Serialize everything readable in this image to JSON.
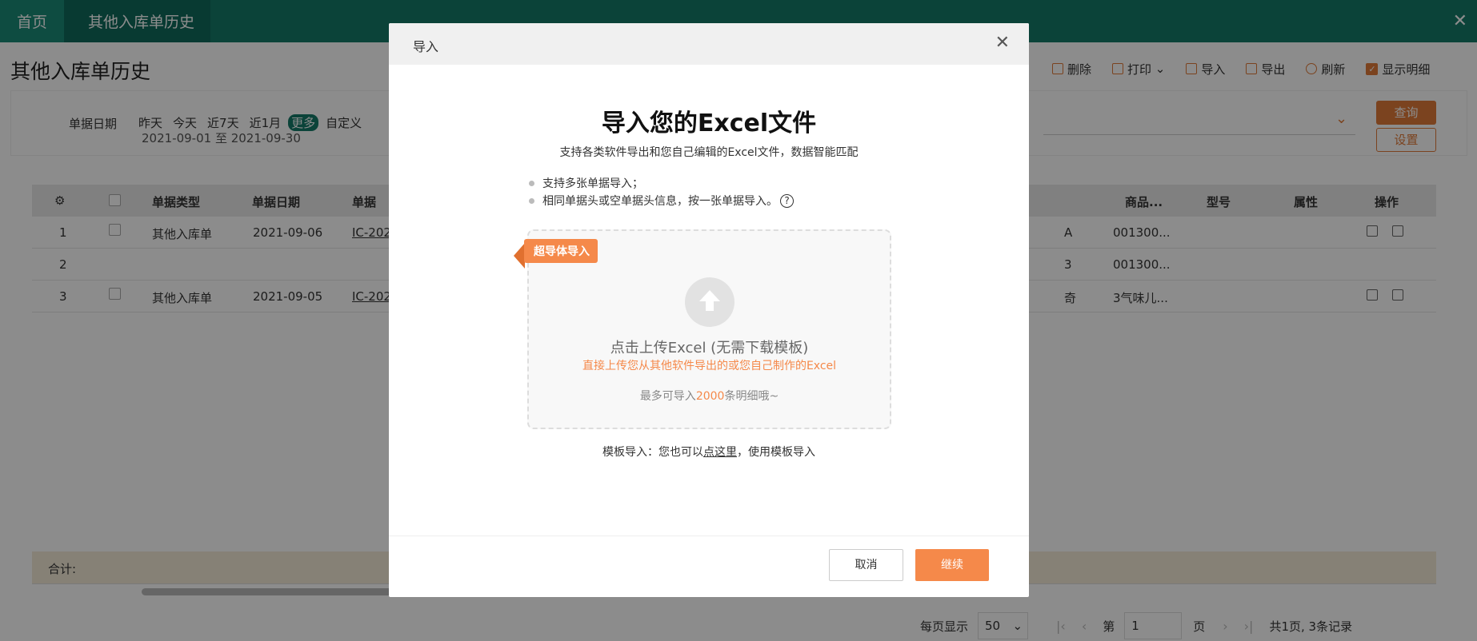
{
  "tabs": {
    "home": "首页",
    "active": "其他入库单历史"
  },
  "page": {
    "title": "其他入库单历史"
  },
  "toolbar": {
    "delete": "删除",
    "print": "打印",
    "import": "导入",
    "export": "导出",
    "refresh": "刷新",
    "show_detail": "显示明细"
  },
  "filter": {
    "label": "单据日期",
    "options": [
      "昨天",
      "今天",
      "近7天",
      "近1月",
      "更多",
      "自定义"
    ],
    "range": "2021-09-01 至 2021-09-30",
    "query": "查询",
    "settings": "设置"
  },
  "table": {
    "headers": {
      "type": "单据类型",
      "date": "单据日期",
      "no": "单据",
      "goods": "商品...",
      "model": "型号",
      "attr": "属性",
      "ops": "操作"
    },
    "rows": [
      {
        "idx": "1",
        "type": "其他入库单",
        "date": "2021-09-06",
        "no": "IC-202",
        "col5": "A",
        "goods": "001300..."
      },
      {
        "idx": "2",
        "type": "",
        "date": "",
        "no": "",
        "col5": "3",
        "goods": "001300..."
      },
      {
        "idx": "3",
        "type": "其他入库单",
        "date": "2021-09-05",
        "no": "IC-202",
        "col5": "奇",
        "goods": "3气味儿..."
      }
    ],
    "sum_label": "合计:"
  },
  "pager": {
    "per_page_label": "每页显示",
    "per_page": "50",
    "page_prefix": "第",
    "page": "1",
    "page_suffix": "页",
    "total": "共1页, 3条记录"
  },
  "modal": {
    "title": "导入",
    "heading": "导入您的Excel文件",
    "subtitle": "支持各类软件导出和您自己编辑的Excel文件，数据智能匹配",
    "bullet1": "支持多张单据导入；",
    "bullet2": "相同单据头或空单据头信息，按一张单据导入。",
    "ribbon": "超导体导入",
    "upload_main": "点击上传Excel (无需下载模板)",
    "upload_sub": "直接上传您从其他软件导出的或您自己制作的Excel",
    "limit_prefix": "最多可导入",
    "limit_num": "2000",
    "limit_suffix": "条明细哦~",
    "template_prefix": "模板导入：您也可以",
    "template_link": "点这里",
    "template_suffix": "，使用模板导入",
    "cancel": "取消",
    "continue": "继续"
  },
  "colors": {
    "brand": "#147a69",
    "accent": "#f5894a"
  }
}
